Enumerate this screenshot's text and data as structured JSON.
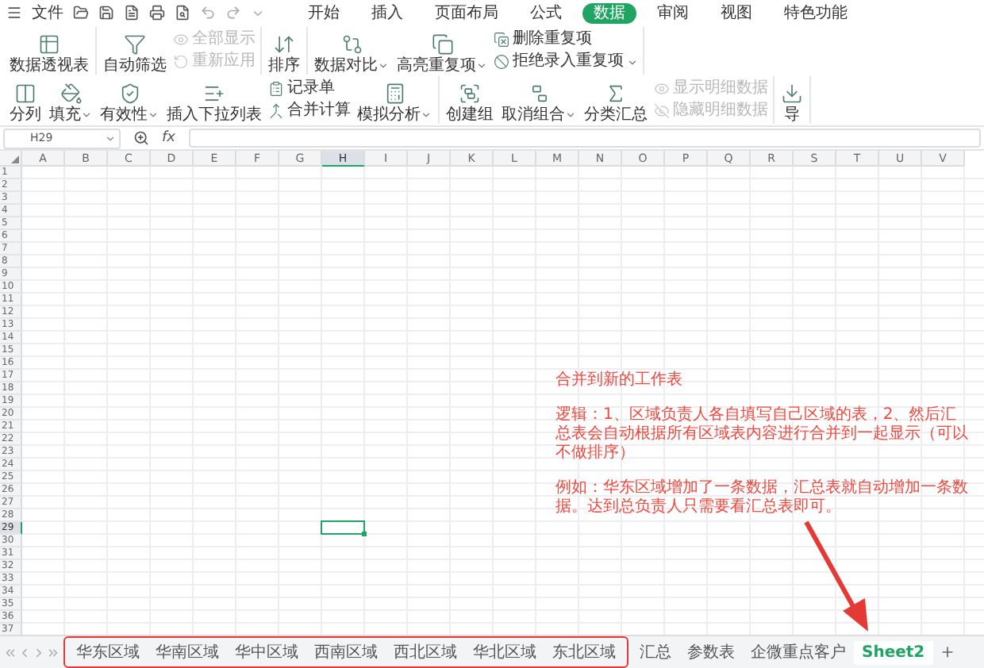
{
  "menu_bar": {
    "file": "文件",
    "tabs": [
      {
        "label": "开始",
        "selected": false
      },
      {
        "label": "插入",
        "selected": false
      },
      {
        "label": "页面布局",
        "selected": false
      },
      {
        "label": "公式",
        "selected": false
      },
      {
        "label": "数据",
        "selected": true
      },
      {
        "label": "审阅",
        "selected": false
      },
      {
        "label": "视图",
        "selected": false
      },
      {
        "label": "特色功能",
        "selected": false
      }
    ]
  },
  "toolbar": {
    "sections": [
      [
        {
          "kind": "large",
          "label": "数据透视表",
          "dropdown": false
        }
      ],
      [
        {
          "kind": "large",
          "label": "自动筛选",
          "dropdown": false
        },
        {
          "kind": "stack",
          "items": [
            {
              "label": "全部显示",
              "disabled": true,
              "dropdown": false
            },
            {
              "label": "重新应用",
              "disabled": true,
              "dropdown": false
            }
          ]
        }
      ],
      [
        {
          "kind": "large",
          "label": "排序",
          "dropdown": false
        }
      ],
      [
        {
          "kind": "large",
          "label": "数据对比",
          "dropdown": true
        },
        {
          "kind": "large",
          "label": "高亮重复项",
          "dropdown": true
        },
        {
          "kind": "stack",
          "items": [
            {
              "label": "删除重复项",
              "disabled": false,
              "dropdown": false
            },
            {
              "label": "拒绝录入重复项",
              "disabled": false,
              "dropdown": true
            }
          ]
        }
      ],
      [
        {
          "kind": "large",
          "label": "分列",
          "dropdown": false
        },
        {
          "kind": "large",
          "label": "填充",
          "dropdown": true
        },
        {
          "kind": "large",
          "label": "有效性",
          "dropdown": true
        },
        {
          "kind": "large",
          "label": "插入下拉列表",
          "dropdown": false
        },
        {
          "kind": "stack",
          "items": [
            {
              "label": "记录单",
              "disabled": false,
              "dropdown": false
            },
            {
              "label": "合并计算",
              "disabled": false,
              "dropdown": false
            }
          ]
        },
        {
          "kind": "large",
          "label": "模拟分析",
          "dropdown": true
        }
      ],
      [
        {
          "kind": "large",
          "label": "创建组",
          "dropdown": false
        },
        {
          "kind": "large",
          "label": "取消组合",
          "dropdown": true
        },
        {
          "kind": "large",
          "label": "分类汇总",
          "dropdown": false
        },
        {
          "kind": "stack",
          "items": [
            {
              "label": "显示明细数据",
              "disabled": true,
              "dropdown": false
            },
            {
              "label": "隐藏明细数据",
              "disabled": true,
              "dropdown": false
            }
          ]
        }
      ],
      [
        {
          "kind": "large",
          "label": "导",
          "dropdown": false
        }
      ]
    ]
  },
  "formula_bar": {
    "name_box": "H29",
    "fx": "fx"
  },
  "columns": [
    {
      "label": "A",
      "selected": false
    },
    {
      "label": "B",
      "selected": false
    },
    {
      "label": "C",
      "selected": false
    },
    {
      "label": "D",
      "selected": false
    },
    {
      "label": "E",
      "selected": false
    },
    {
      "label": "F",
      "selected": false
    },
    {
      "label": "G",
      "selected": false
    },
    {
      "label": "H",
      "selected": true
    },
    {
      "label": "I",
      "selected": false
    },
    {
      "label": "J",
      "selected": false
    },
    {
      "label": "K",
      "selected": false
    },
    {
      "label": "L",
      "selected": false
    },
    {
      "label": "M",
      "selected": false
    },
    {
      "label": "N",
      "selected": false
    },
    {
      "label": "O",
      "selected": false
    },
    {
      "label": "P",
      "selected": false
    },
    {
      "label": "Q",
      "selected": false
    },
    {
      "label": "R",
      "selected": false
    },
    {
      "label": "S",
      "selected": false
    },
    {
      "label": "T",
      "selected": false
    },
    {
      "label": "U",
      "selected": false
    },
    {
      "label": "V",
      "selected": false
    }
  ],
  "rows": [
    {
      "label": "1",
      "selected": false
    },
    {
      "label": "2",
      "selected": false
    },
    {
      "label": "3",
      "selected": false
    },
    {
      "label": "4",
      "selected": false
    },
    {
      "label": "5",
      "selected": false
    },
    {
      "label": "6",
      "selected": false
    },
    {
      "label": "7",
      "selected": false
    },
    {
      "label": "8",
      "selected": false
    },
    {
      "label": "9",
      "selected": false
    },
    {
      "label": "10",
      "selected": false
    },
    {
      "label": "11",
      "selected": false
    },
    {
      "label": "12",
      "selected": false
    },
    {
      "label": "13",
      "selected": false
    },
    {
      "label": "14",
      "selected": false
    },
    {
      "label": "15",
      "selected": false
    },
    {
      "label": "16",
      "selected": false
    },
    {
      "label": "17",
      "selected": false
    },
    {
      "label": "18",
      "selected": false
    },
    {
      "label": "19",
      "selected": false
    },
    {
      "label": "20",
      "selected": false
    },
    {
      "label": "21",
      "selected": false
    },
    {
      "label": "22",
      "selected": false
    },
    {
      "label": "23",
      "selected": false
    },
    {
      "label": "24",
      "selected": false
    },
    {
      "label": "25",
      "selected": false
    },
    {
      "label": "26",
      "selected": false
    },
    {
      "label": "27",
      "selected": false
    },
    {
      "label": "28",
      "selected": false
    },
    {
      "label": "29",
      "selected": true
    },
    {
      "label": "30",
      "selected": false
    },
    {
      "label": "31",
      "selected": false
    },
    {
      "label": "32",
      "selected": false
    },
    {
      "label": "33",
      "selected": false
    },
    {
      "label": "34",
      "selected": false
    },
    {
      "label": "35",
      "selected": false
    },
    {
      "label": "36",
      "selected": false
    },
    {
      "label": "37",
      "selected": false
    }
  ],
  "annotation": {
    "title": "合并到新的工作表",
    "paragraphs": [
      "逻辑：1、区域负责人各自填写自己区域的表，2、然后汇总表会自动根据所有区域表内容进行合并到一起显示（可以不做排序）",
      "例如：华东区域增加了一条数据，汇总表就自动增加一条数据。达到总负责人只需要看汇总表即可。"
    ]
  },
  "sheet_tabs": [
    {
      "label": "华东区域",
      "selected": false,
      "boxed": true
    },
    {
      "label": "华南区域",
      "selected": false,
      "boxed": true
    },
    {
      "label": "华中区域",
      "selected": false,
      "boxed": true
    },
    {
      "label": "西南区域",
      "selected": false,
      "boxed": true
    },
    {
      "label": "西北区域",
      "selected": false,
      "boxed": true
    },
    {
      "label": "华北区域",
      "selected": false,
      "boxed": true
    },
    {
      "label": "东北区域",
      "selected": false,
      "boxed": true
    },
    {
      "label": "汇总",
      "selected": false,
      "boxed": false
    },
    {
      "label": "参数表",
      "selected": false,
      "boxed": false
    },
    {
      "label": "企微重点客户",
      "selected": false,
      "boxed": false
    },
    {
      "label": "Sheet2",
      "selected": true,
      "boxed": false
    }
  ]
}
